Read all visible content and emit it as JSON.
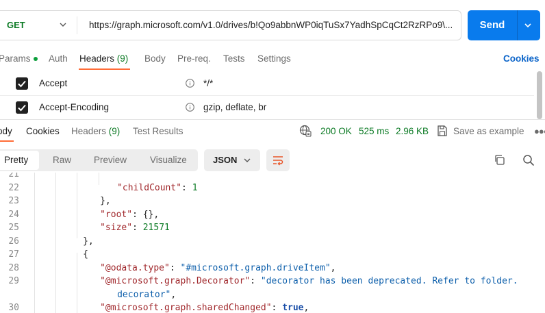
{
  "request": {
    "method": "GET",
    "url": "https://graph.microsoft.com/v1.0/drives/b!Qo9abbnWP0iqTuSx7YadhSpCqCt2RzRPo9\\...",
    "send_label": "Send"
  },
  "request_tabs": [
    {
      "label": "Params",
      "count": ""
    },
    {
      "label": "Auth",
      "count": ""
    },
    {
      "label": "Headers",
      "count": "(9)"
    },
    {
      "label": "Body",
      "count": ""
    },
    {
      "label": "Pre-req.",
      "count": ""
    },
    {
      "label": "Tests",
      "count": ""
    },
    {
      "label": "Settings",
      "count": ""
    }
  ],
  "cookies_link": "Cookies",
  "headers": [
    {
      "key": "Accept",
      "value": "*/*",
      "checked": true
    },
    {
      "key": "Accept-Encoding",
      "value": "gzip, deflate, br",
      "checked": true
    }
  ],
  "response_tabs": [
    {
      "label": "ody",
      "count": ""
    },
    {
      "label": "Cookies",
      "count": ""
    },
    {
      "label": "Headers",
      "count": "(9)"
    },
    {
      "label": "Test Results",
      "count": ""
    }
  ],
  "status": {
    "code": "200 OK",
    "time": "525 ms",
    "size": "2.96 KB"
  },
  "save_example": "Save as example",
  "view_tabs": [
    "Pretty",
    "Raw",
    "Preview",
    "Visualize"
  ],
  "format": "JSON",
  "code": {
    "lines": [
      {
        "n": "21",
        "html": ""
      },
      {
        "n": "22",
        "indent": 5,
        "parts": [
          [
            "k",
            "\"childCount\""
          ],
          [
            "p",
            ": "
          ],
          [
            "n",
            "1"
          ]
        ]
      },
      {
        "n": "23",
        "indent": 4,
        "parts": [
          [
            "p",
            "},"
          ]
        ]
      },
      {
        "n": "24",
        "indent": 4,
        "parts": [
          [
            "k",
            "\"root\""
          ],
          [
            "p",
            ": {},"
          ]
        ]
      },
      {
        "n": "25",
        "indent": 4,
        "parts": [
          [
            "k",
            "\"size\""
          ],
          [
            "p",
            ": "
          ],
          [
            "n",
            "21571"
          ]
        ]
      },
      {
        "n": "26",
        "indent": 3,
        "parts": [
          [
            "p",
            "},"
          ]
        ]
      },
      {
        "n": "27",
        "indent": 3,
        "parts": [
          [
            "p",
            "{"
          ]
        ]
      },
      {
        "n": "28",
        "indent": 4,
        "parts": [
          [
            "k",
            "\"@odata.type\""
          ],
          [
            "p",
            ": "
          ],
          [
            "s",
            "\"#microsoft.graph.driveItem\""
          ],
          [
            "p",
            ","
          ]
        ]
      },
      {
        "n": "29",
        "indent": 4,
        "parts": [
          [
            "k",
            "\"@microsoft.graph.Decorator\""
          ],
          [
            "p",
            ": "
          ],
          [
            "s",
            "\"decorator has been deprecated. Refer to folder."
          ]
        ]
      },
      {
        "n": "",
        "indent": 5,
        "parts": [
          [
            "s",
            "decorator\""
          ],
          [
            "p",
            ","
          ]
        ]
      },
      {
        "n": "30",
        "indent": 4,
        "parts": [
          [
            "k",
            "\"@microsoft.graph.sharedChanged\""
          ],
          [
            "p",
            ": "
          ],
          [
            "b",
            "true"
          ],
          [
            "p",
            ","
          ]
        ]
      }
    ]
  }
}
